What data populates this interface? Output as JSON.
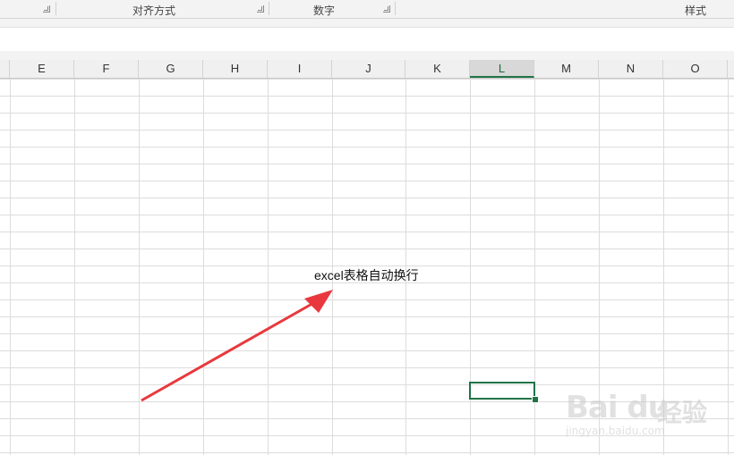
{
  "ribbon": {
    "groups": [
      {
        "label": ""
      },
      {
        "label": "对齐方式"
      },
      {
        "label": "数字"
      },
      {
        "label": "样式"
      }
    ]
  },
  "columns": [
    "E",
    "F",
    "G",
    "H",
    "I",
    "J",
    "K",
    "L",
    "M",
    "N",
    "O"
  ],
  "active_column": "L",
  "cell_text": "excel表格自动换行",
  "watermark": {
    "brand": "Bai du",
    "cn": "经验",
    "url": "jingyan.baidu.com"
  },
  "colors": {
    "selection": "#217346",
    "arrow": "#e8383d"
  }
}
